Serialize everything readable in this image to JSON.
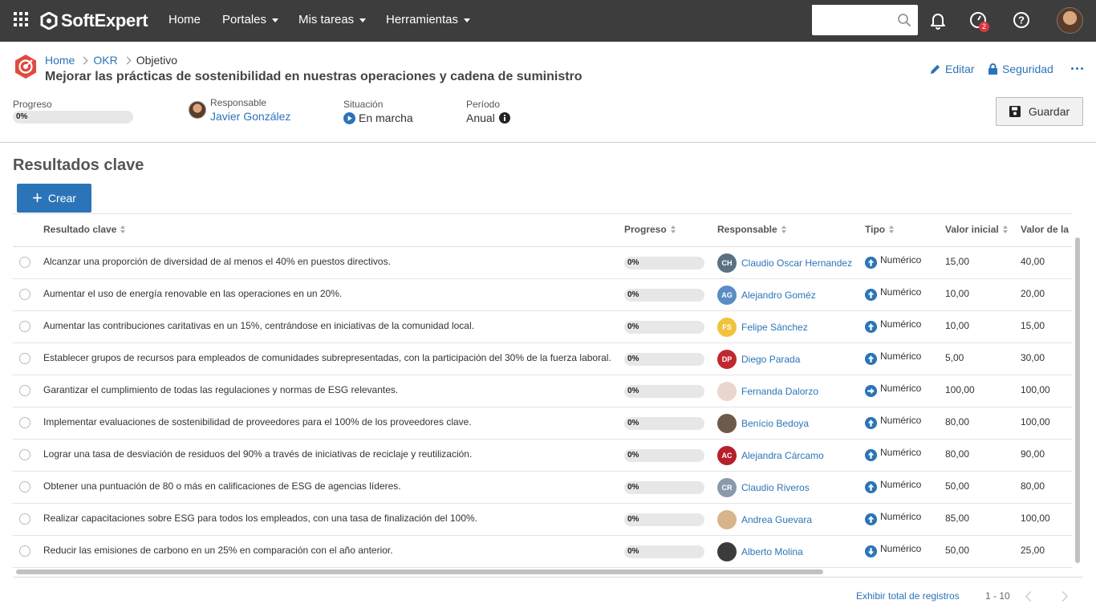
{
  "app": {
    "brand": "SoftExpert"
  },
  "nav": [
    {
      "label": "Home"
    },
    {
      "label": "Portales"
    },
    {
      "label": "Mis tareas"
    },
    {
      "label": "Herramientas"
    }
  ],
  "search": {
    "value": "",
    "placeholder": ""
  },
  "notifications": {
    "badge": "2"
  },
  "breadcrumb": {
    "home": "Home",
    "okr": "OKR",
    "current": "Objetivo"
  },
  "objective": {
    "title": "Mejorar las prácticas de sostenibilidad en nuestras operaciones y cadena de suministro"
  },
  "actions": {
    "edit": "Editar",
    "security": "Seguridad",
    "save": "Guardar"
  },
  "meta": {
    "progress_label": "Progreso",
    "progress_value": "0%",
    "owner_label": "Responsable",
    "owner": "Javier González",
    "status_label": "Situación",
    "status": "En marcha",
    "period_label": "Período",
    "period": "Anual"
  },
  "key_results": {
    "title": "Resultados clave",
    "create_label": "Crear",
    "columns": {
      "name": "Resultado clave",
      "progress": "Progreso",
      "owner": "Responsable",
      "type": "Tipo",
      "initial": "Valor inicial",
      "goal": "Valor de la"
    },
    "rows": [
      {
        "name": "Alcanzar una proporción de diversidad de al menos el 40% en puestos directivos.",
        "progress": "0%",
        "initials": "CH",
        "avatar_color": "#5a7184",
        "owner": "Claudio Oscar Hernandez",
        "type": "Numérico",
        "direction": "up",
        "initial": "15,00",
        "goal": "40,00"
      },
      {
        "name": "Aumentar el uso de energía renovable en las operaciones en un 20%.",
        "progress": "0%",
        "initials": "AG",
        "avatar_color": "#5b8cc4",
        "owner": "Alejandro Goméz",
        "type": "Numérico",
        "direction": "up",
        "initial": "10,00",
        "goal": "20,00"
      },
      {
        "name": "Aumentar las contribuciones caritativas en un 15%, centrándose en iniciativas de la comunidad local.",
        "progress": "0%",
        "initials": "FS",
        "avatar_color": "#f2c23c",
        "owner": "Felipe Sánchez",
        "type": "Numérico",
        "direction": "up",
        "initial": "10,00",
        "goal": "15,00"
      },
      {
        "name": "Establecer grupos de recursos para empleados de comunidades subrepresentadas, con la participación del 30% de la fuerza laboral.",
        "progress": "0%",
        "initials": "DP",
        "avatar_color": "#c0282f",
        "owner": "Diego Parada",
        "type": "Numérico",
        "direction": "up",
        "initial": "5,00",
        "goal": "30,00"
      },
      {
        "name": "Garantizar el cumplimiento de todas las regulaciones y normas de ESG relevantes.",
        "progress": "0%",
        "initials": "",
        "avatar_color": "#e9d7cf",
        "owner": "Fernanda Dalorzo",
        "type": "Numérico",
        "direction": "right",
        "initial": "100,00",
        "goal": "100,00"
      },
      {
        "name": "Implementar evaluaciones de sostenibilidad de proveedores para el 100% de los proveedores clave.",
        "progress": "0%",
        "initials": "",
        "avatar_color": "#6d5a4a",
        "owner": "Benício Bedoya",
        "type": "Numérico",
        "direction": "up",
        "initial": "80,00",
        "goal": "100,00"
      },
      {
        "name": "Lograr una tasa de desviación de residuos del 90% a través de iniciativas de reciclaje y reutilización.",
        "progress": "0%",
        "initials": "AC",
        "avatar_color": "#b5202a",
        "owner": "Alejandra Cárcamo",
        "type": "Numérico",
        "direction": "up",
        "initial": "80,00",
        "goal": "90,00"
      },
      {
        "name": "Obtener una puntuación de 80 o más en calificaciones de ESG de agencias líderes.",
        "progress": "0%",
        "initials": "CR",
        "avatar_color": "#8a9aaa",
        "owner": "Claudio Riveros",
        "type": "Numérico",
        "direction": "up",
        "initial": "50,00",
        "goal": "80,00"
      },
      {
        "name": "Realizar capacitaciones sobre ESG para todos los empleados, con una tasa de finalización del 100%.",
        "progress": "0%",
        "initials": "",
        "avatar_color": "#d8b48a",
        "owner": "Andrea Guevara",
        "type": "Numérico",
        "direction": "up",
        "initial": "85,00",
        "goal": "100,00"
      },
      {
        "name": "Reducir las emisiones de carbono en un 25% en comparación con el año anterior.",
        "progress": "0%",
        "initials": "",
        "avatar_color": "#3b3b3b",
        "owner": "Alberto Molina",
        "type": "Numérico",
        "direction": "down",
        "initial": "50,00",
        "goal": "25,00"
      }
    ]
  },
  "footer": {
    "show_total": "Exhibir total de registros",
    "range": "1 - 10"
  },
  "colors": {
    "accent": "#2c74b8",
    "topbar": "#3d3d3d",
    "brand_icon": "#e04a3f"
  }
}
